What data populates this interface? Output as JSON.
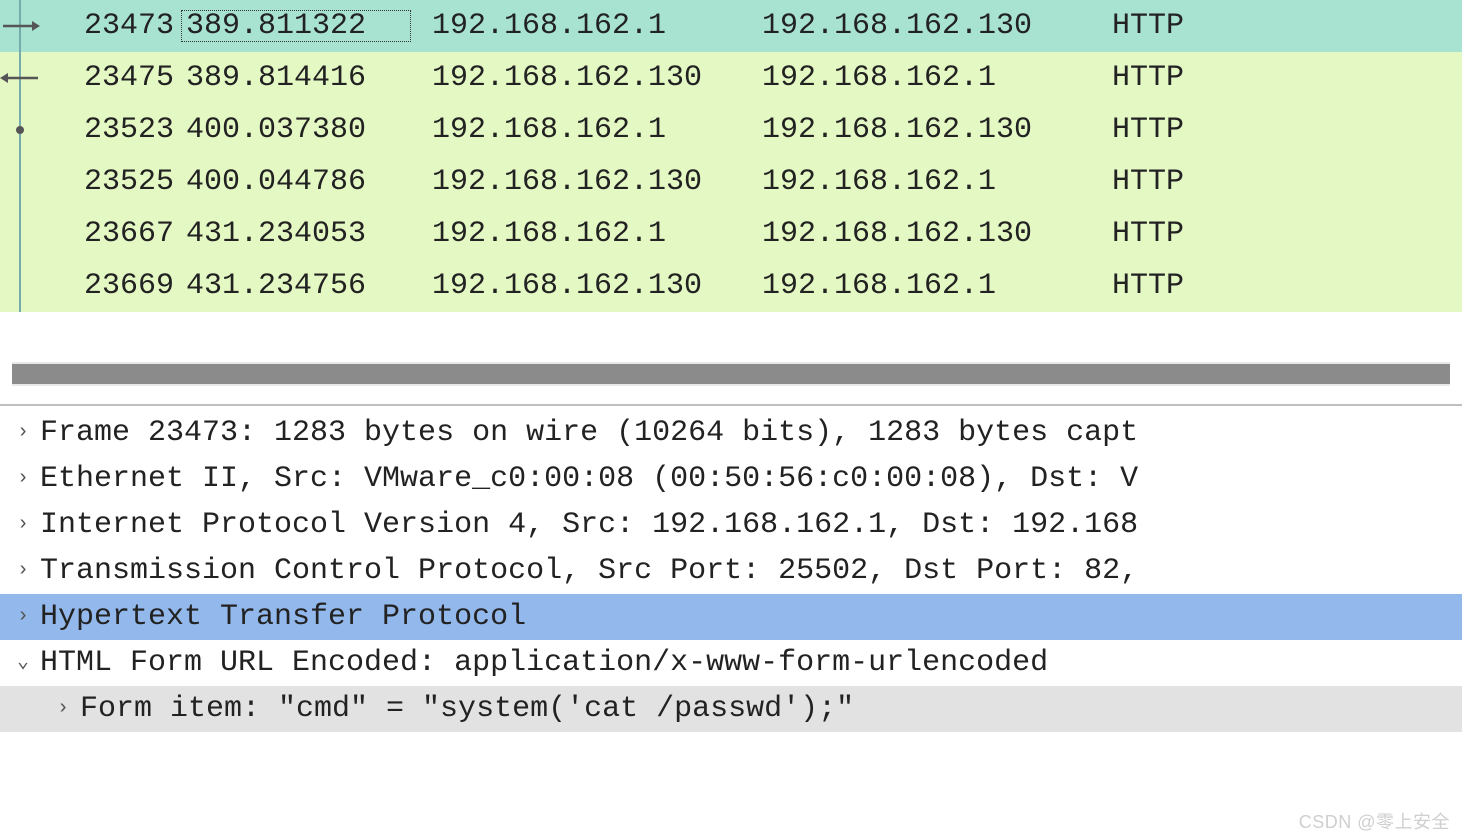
{
  "packets": [
    {
      "no": "23473",
      "time": "389.811322",
      "src": "192.168.162.1",
      "dst": "192.168.162.130",
      "proto": "HTTP",
      "selected": true,
      "marker": "right",
      "focusTime": true
    },
    {
      "no": "23475",
      "time": "389.814416",
      "src": "192.168.162.130",
      "dst": "192.168.162.1",
      "proto": "HTTP",
      "selected": false,
      "marker": "left",
      "focusTime": false
    },
    {
      "no": "23523",
      "time": "400.037380",
      "src": "192.168.162.1",
      "dst": "192.168.162.130",
      "proto": "HTTP",
      "selected": false,
      "marker": "dot",
      "focusTime": false
    },
    {
      "no": "23525",
      "time": "400.044786",
      "src": "192.168.162.130",
      "dst": "192.168.162.1",
      "proto": "HTTP",
      "selected": false,
      "marker": "none",
      "focusTime": false
    },
    {
      "no": "23667",
      "time": "431.234053",
      "src": "192.168.162.1",
      "dst": "192.168.162.130",
      "proto": "HTTP",
      "selected": false,
      "marker": "none",
      "focusTime": false
    },
    {
      "no": "23669",
      "time": "431.234756",
      "src": "192.168.162.130",
      "dst": "192.168.162.1",
      "proto": "HTTP",
      "selected": false,
      "marker": "none",
      "focusTime": false
    }
  ],
  "details": {
    "frame": "Frame 23473: 1283 bytes on wire (10264 bits), 1283 bytes capt",
    "eth": "Ethernet II, Src: VMware_c0:00:08 (00:50:56:c0:00:08), Dst: V",
    "ip": "Internet Protocol Version 4, Src: 192.168.162.1, Dst: 192.168",
    "tcp": "Transmission Control Protocol, Src Port: 25502, Dst Port: 82,",
    "http": "Hypertext Transfer Protocol",
    "form": "HTML Form URL Encoded: application/x-www-form-urlencoded",
    "formItem": "Form item: \"cmd\" = \"system('cat /passwd');\""
  },
  "watermark": "CSDN @零上安全"
}
